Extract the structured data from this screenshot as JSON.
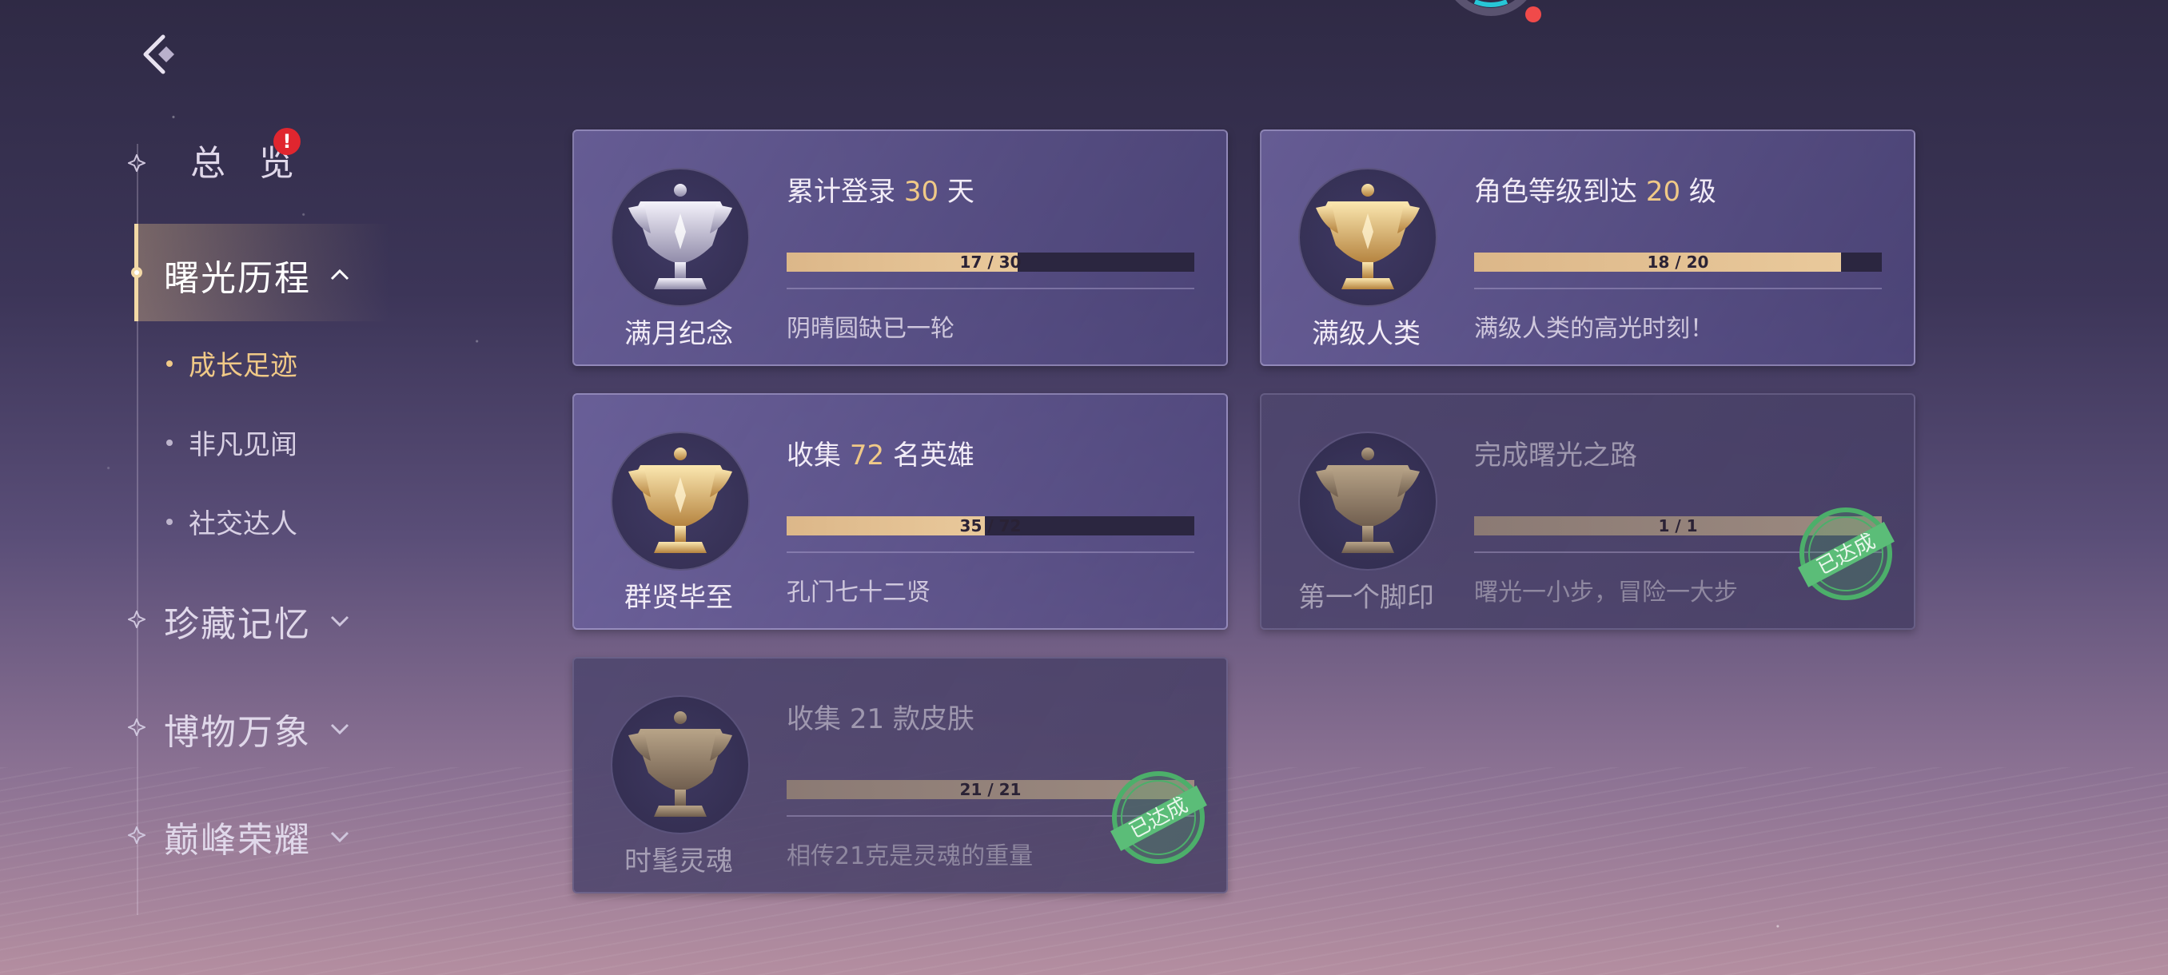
{
  "nav": {
    "overview": {
      "label": "总 览",
      "badge": "!"
    },
    "groups": [
      {
        "label": "曙光历程",
        "expanded": true
      },
      {
        "label": "珍藏记忆",
        "expanded": false
      },
      {
        "label": "博物万象",
        "expanded": false
      },
      {
        "label": "巅峰荣耀",
        "expanded": false
      }
    ],
    "sub_items": [
      "成长足迹",
      "非凡见闻",
      "社交达人"
    ],
    "active_sub": "成长足迹"
  },
  "colors": {
    "accent": "#f0c987",
    "badge": "#e0262f",
    "stamp": "#4caf6a"
  },
  "achievements": [
    {
      "name": "满月纪念",
      "title_pre": "累计登录",
      "num": "30",
      "title_post": "天",
      "progress": "17 / 30",
      "fraction": 0.567,
      "desc": "阴晴圆缺已一轮",
      "completed": false,
      "trophy": "silver-trophy-icon"
    },
    {
      "name": "满级人类",
      "title_pre": "角色等级到达",
      "num": "20",
      "title_post": "级",
      "progress": "18 / 20",
      "fraction": 0.9,
      "desc": "满级人类的高光时刻！",
      "completed": false,
      "trophy": "gold-trophy-icon"
    },
    {
      "name": "群贤毕至",
      "title_pre": "收集",
      "num": "72",
      "title_post": "名英雄",
      "progress": "35 / 72",
      "fraction": 0.486,
      "desc": "孔门七十二贤",
      "completed": false,
      "trophy": "gold-trophy-icon"
    },
    {
      "name": "第一个脚印",
      "title_pre": "完成曙光之路",
      "num": "",
      "title_post": "",
      "progress": "1 / 1",
      "fraction": 1.0,
      "desc": "曙光一小步，冒险一大步",
      "completed": true,
      "stamp": "已达成",
      "trophy": "bronze-trophy-icon"
    },
    {
      "name": "时髦灵魂",
      "title_pre": "收集",
      "num": "21",
      "title_post": "款皮肤",
      "progress": "21 / 21",
      "fraction": 1.0,
      "desc": "相传21克是灵魂的重量",
      "completed": true,
      "stamp": "已达成",
      "trophy": "bronze-trophy-icon"
    }
  ]
}
